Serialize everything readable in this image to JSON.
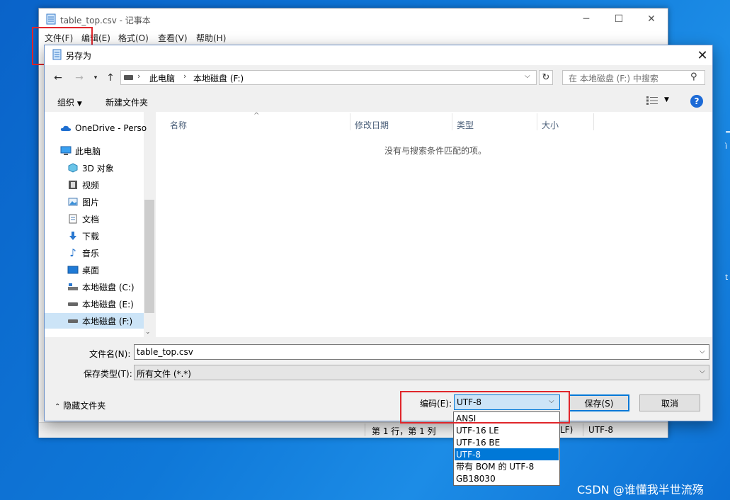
{
  "notepad": {
    "title": "table_top.csv - 记事本",
    "menu": [
      "文件(F)",
      "编辑(E)",
      "格式(O)",
      "查看(V)",
      "帮助(H)"
    ],
    "status": {
      "position": "第 1 行，第 1 列",
      "line_ending": "LF)",
      "encoding": "UTF-8"
    }
  },
  "dialog": {
    "title": "另存为",
    "path": [
      "此电脑",
      "本地磁盘 (F:)"
    ],
    "search_placeholder": "在 本地磁盘 (F:) 中搜索",
    "toolbar": {
      "organize": "组织",
      "new_folder": "新建文件夹"
    },
    "nav_items": [
      {
        "label": "OneDrive - Perso",
        "icon": "onedrive-icon"
      },
      {
        "label": "此电脑",
        "icon": "computer-icon"
      },
      {
        "label": "3D 对象",
        "icon": "3d-objects-icon"
      },
      {
        "label": "视频",
        "icon": "video-icon"
      },
      {
        "label": "图片",
        "icon": "pictures-icon"
      },
      {
        "label": "文档",
        "icon": "documents-icon"
      },
      {
        "label": "下载",
        "icon": "download-icon"
      },
      {
        "label": "音乐",
        "icon": "music-icon"
      },
      {
        "label": "桌面",
        "icon": "desktop-icon"
      },
      {
        "label": "本地磁盘 (C:)",
        "icon": "drive-icon"
      },
      {
        "label": "本地磁盘 (E:)",
        "icon": "drive-icon"
      },
      {
        "label": "本地磁盘 (F:)",
        "icon": "drive-icon"
      }
    ],
    "columns": [
      "名称",
      "修改日期",
      "类型",
      "大小"
    ],
    "empty_message": "没有与搜索条件匹配的项。",
    "filename_label": "文件名(N):",
    "filename_value": "table_top.csv",
    "filetype_label": "保存类型(T):",
    "filetype_value": "所有文件  (*.*)",
    "hide_folders": "隐藏文件夹",
    "encoding_label": "编码(E):",
    "encoding_value": "UTF-8",
    "save_button": "保存(S)",
    "cancel_button": "取消"
  },
  "encoding_options": [
    "ANSI",
    "UTF-16 LE",
    "UTF-16 BE",
    "UTF-8",
    "带有 BOM 的 UTF-8",
    "GB18030"
  ],
  "encoding_selected_index": 3,
  "watermark": "CSDN @谁懂我半世流殇",
  "colors": {
    "accent": "#0078d7",
    "highlight_box": "#e0262b",
    "selection": "#cce4f7"
  }
}
